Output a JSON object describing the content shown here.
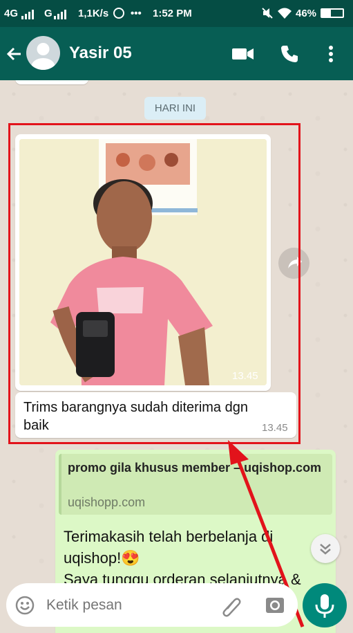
{
  "status": {
    "network1": "4G",
    "network2": "G",
    "speed": "1,1K/s",
    "dots": "•••",
    "time": "1:52 PM",
    "battery": "46%"
  },
  "header": {
    "contact_name": "Yasir 05",
    "icons": [
      "back-arrow-icon",
      "avatar",
      "video-call-icon",
      "phone-icon",
      "more-vert-icon"
    ]
  },
  "chat": {
    "date_chip": "HARI INI",
    "photo_message": {
      "time": "13.45",
      "caption": "Trims barangnya sudah diterima dgn baik",
      "caption_time": "13.45"
    },
    "outgoing": {
      "link_title": "promo gila khusus member – uqishop.com",
      "link_domain": "uqishopp.com",
      "text_line1": "Terimakasih telah berbelanja di",
      "text_line2": "uqishop!😍",
      "text_line3": "Saya tunggu orderan selanjutnya &"
    }
  },
  "composer": {
    "placeholder": "Ketik pesan"
  },
  "colors": {
    "statusbar": "#054d44",
    "appbar": "#075e54",
    "chat_bg": "#e6ddd4",
    "outgoing_bubble": "#dcf8c6",
    "highlight": "#e2131b",
    "mic_button": "#00897b"
  }
}
